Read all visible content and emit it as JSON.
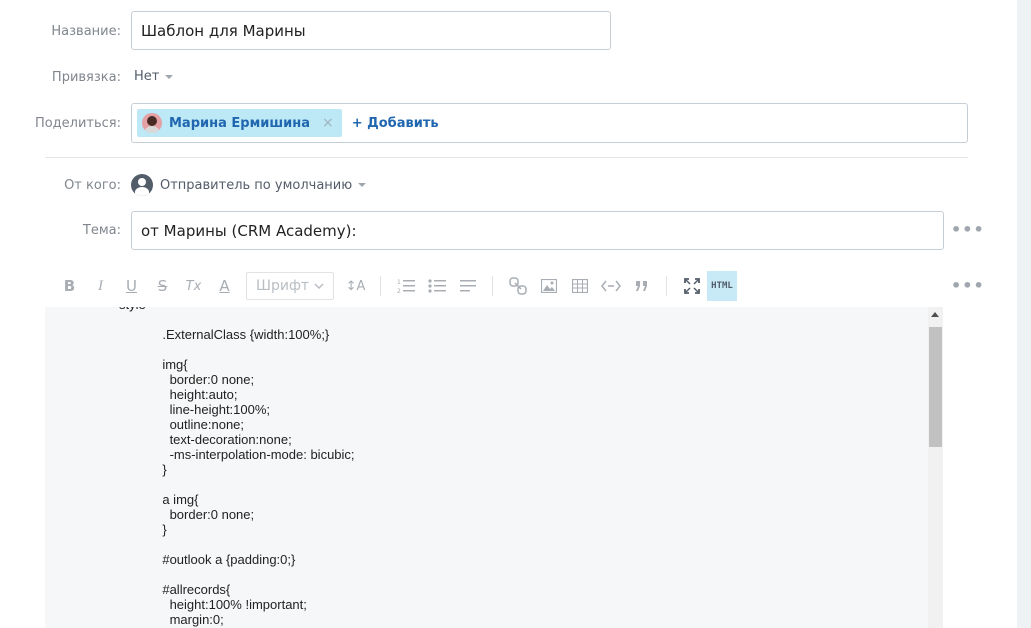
{
  "form": {
    "name_label": "Название:",
    "name_value": "Шаблон для Марины",
    "binding_label": "Привязка:",
    "binding_value": "Нет",
    "share_label": "Поделиться:",
    "share_user": "Марина Ермишина",
    "share_remove": "×",
    "share_add": "+ Добавить",
    "from_label": "От кого:",
    "from_value": "Отправитель по умолчанию",
    "subject_label": "Тема:",
    "subject_value": "от Марины (CRM Academy):",
    "more": "•••"
  },
  "toolbar": {
    "bold": "B",
    "italic": "I",
    "underline": "U",
    "strike": "S",
    "clear_format": "Tx",
    "font_color": "A",
    "font_placeholder": "Шрифт",
    "font_size": "↕A",
    "html_label": "HTML",
    "more": "•••"
  },
  "editor": {
    "code": "style\n\n            .ExternalClass {width:100%;}\n\n            img{\n              border:0 none;\n              height:auto;\n              line-height:100%;\n              outline:none;\n              text-decoration:none;\n              -ms-interpolation-mode: bicubic;\n            }\n\n            a img{\n              border:0 none;\n            }\n\n            #outlook a {padding:0;}\n\n            #allrecords{\n              height:100% !important;\n              margin:0;"
  },
  "colors": {
    "accent": "#2067b0",
    "chip_bg": "#bde8f5",
    "label": "#80868e"
  }
}
